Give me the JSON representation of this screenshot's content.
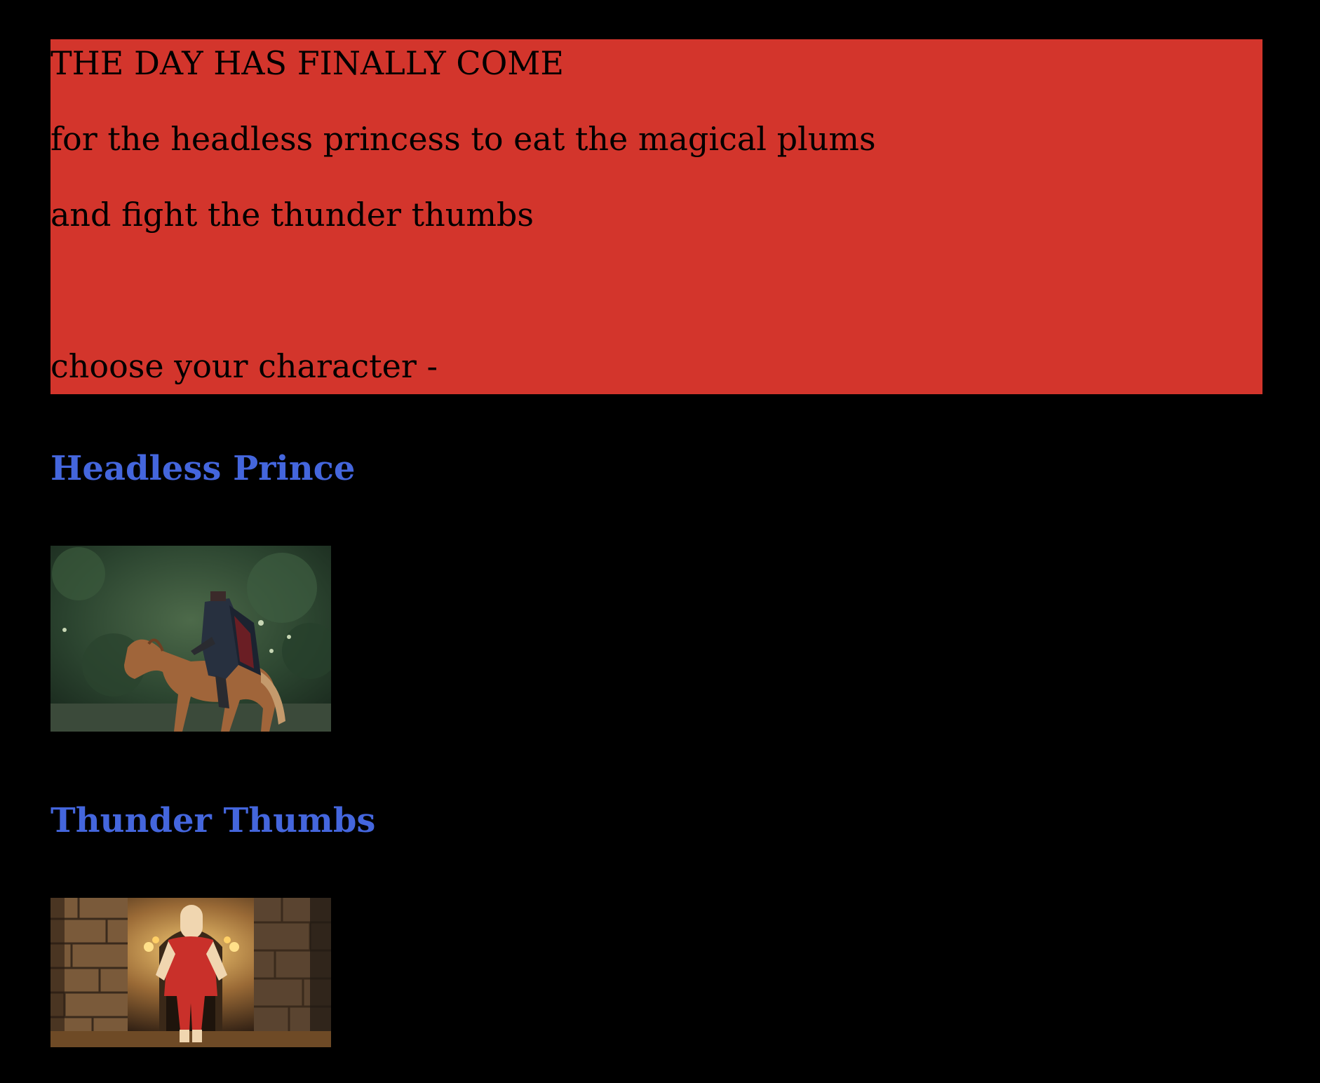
{
  "intro": {
    "line1": "THE DAY HAS FINALLY COME",
    "line2": "for the headless princess to eat the magical plums",
    "line3": "and fight the thunder thumbs",
    "line4": "choose your character -"
  },
  "characters": [
    {
      "name": "Headless Prince"
    },
    {
      "name": "Thunder Thumbs"
    }
  ],
  "colors": {
    "background": "#000000",
    "story_box": "#d3352c",
    "link": "#4466dd"
  }
}
